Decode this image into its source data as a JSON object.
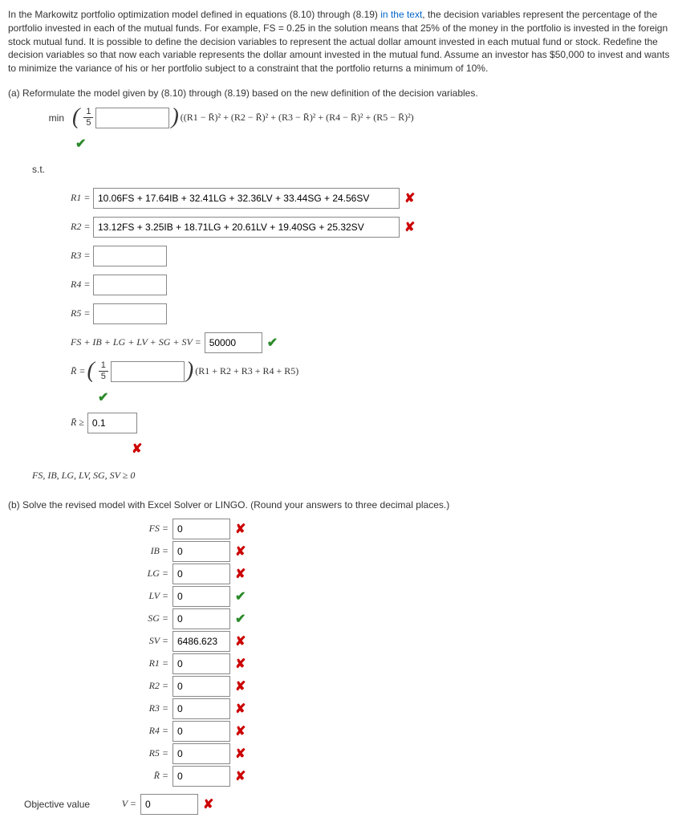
{
  "intro": {
    "part1": "In the Markowitz portfolio optimization model defined in equations (8.10) through (8.19) ",
    "link": "in the text",
    "part2": ", the decision variables represent the percentage of the portfolio invested in each of the mutual funds. For example, FS = 0.25 in the solution means that 25% of the money in the portfolio is invested in the foreign stock mutual fund. It is possible to define the decision variables to represent the actual dollar amount invested in each mutual fund or stock. Redefine the decision variables so that now each variable represents the dollar amount invested in the mutual fund. Assume an investor has $50,000 to invest and wants to minimize the variance of his or her portfolio subject to a constraint that the portfolio returns a minimum of 10%."
  },
  "parts": {
    "a": "(a)   Reformulate the model given by (8.10) through (8.19) based on the new definition of the decision variables.",
    "b": "(b)   Solve the revised model with Excel Solver or LINGO. (Round your answers to three decimal places.)"
  },
  "labels": {
    "min": "min",
    "st": "s.t.",
    "r1": "R1 =",
    "r2": "R2 =",
    "r3": "R3 =",
    "r4": "R4 =",
    "r5": "R5 =",
    "sumEq": "FS + IB + LG + LV + SG + SV =",
    "rbarEq": "R̄ =",
    "rbarGe": "R̄ ≥",
    "nonneg": "FS, IB, LG, LV, SG, SV ≥ 0",
    "frac_n": "1",
    "frac_d": "5",
    "varFormula": "((R1 − R̄)² + (R2 − R̄)² + (R3 − R̄)² + (R4 − R̄)² + (R5 − R̄)²)",
    "sumR": "(R1 + R2 + R3 + R4 + R5)"
  },
  "inputs": {
    "minCoef": "",
    "r1Val": "10.06FS + 17.64IB + 32.41LG + 32.36LV + 33.44SG + 24.56SV",
    "r2Val": "13.12FS + 3.25IB + 18.71LG + 20.61LV + 19.40SG + 25.32SV",
    "r3Val": "",
    "r4Val": "",
    "r5Val": "",
    "sumVal": "50000",
    "rbarCoef": "",
    "rbarGeVal": "0.1"
  },
  "results": {
    "FS": "0",
    "IB": "0",
    "LG": "0",
    "LV": "0",
    "SG": "0",
    "SV": "6486.623",
    "R1": "0",
    "R2": "0",
    "R3": "0",
    "R4": "0",
    "R5": "0",
    "Rbar": "0",
    "V": "0"
  },
  "resultLabels": {
    "FS": "FS  = ",
    "IB": "IB  = ",
    "LG": "LG  = ",
    "LV": "LV  = ",
    "SG": "SG  = ",
    "SV": "SV  = ",
    "R1": "R1  = ",
    "R2": "R2  = ",
    "R3": "R3  = ",
    "R4": "R4  = ",
    "R5": "R5  = ",
    "Rbar": "R̄  = ",
    "V": "V  = ",
    "obj": "Objective value"
  }
}
